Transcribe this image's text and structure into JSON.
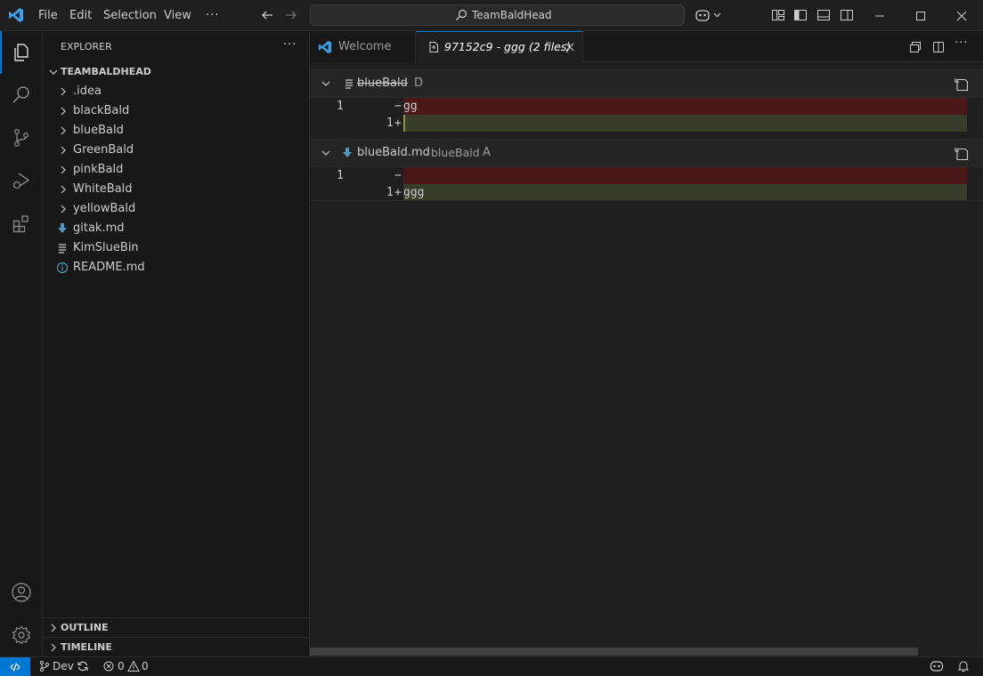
{
  "menu": {
    "file": "File",
    "edit": "Edit",
    "selection": "Selection",
    "view": "View",
    "more": "···"
  },
  "search": {
    "text": "TeamBaldHead"
  },
  "sidebar": {
    "title": "EXPLORER",
    "more": "···",
    "root": "TEAMBALDHEAD",
    "items": [
      {
        "label": ".idea",
        "kind": "folder"
      },
      {
        "label": "blackBald",
        "kind": "folder"
      },
      {
        "label": "blueBald",
        "kind": "folder"
      },
      {
        "label": "GreenBald",
        "kind": "folder"
      },
      {
        "label": "pinkBald",
        "kind": "folder"
      },
      {
        "label": "WhiteBald",
        "kind": "folder"
      },
      {
        "label": "yellowBald",
        "kind": "folder"
      },
      {
        "label": "gitak.md",
        "kind": "markdown-file"
      },
      {
        "label": "KimSlueBin",
        "kind": "text-file"
      },
      {
        "label": "README.md",
        "kind": "info-file"
      }
    ],
    "outline": "OUTLINE",
    "timeline": "TIMELINE"
  },
  "tabs": {
    "welcome": "Welcome",
    "diff": "97152c9 - ggg (2 files)"
  },
  "diff": {
    "file1": {
      "name": "blueBald",
      "status": "D",
      "old_line_no": "1",
      "old_text": "gg",
      "new_line_no": "1",
      "new_text": ""
    },
    "file2": {
      "name": "blueBald.md",
      "path": "blueBald",
      "status": "A",
      "old_line_no": "1",
      "old_text": "",
      "new_line_no": "1",
      "new_text": "ggg"
    }
  },
  "status": {
    "branch": "Dev",
    "errors": "0",
    "warnings": "0"
  },
  "colors": {
    "accent": "#0078d4",
    "removed_bg": "#4b1818",
    "added_bg": "#373d29"
  }
}
